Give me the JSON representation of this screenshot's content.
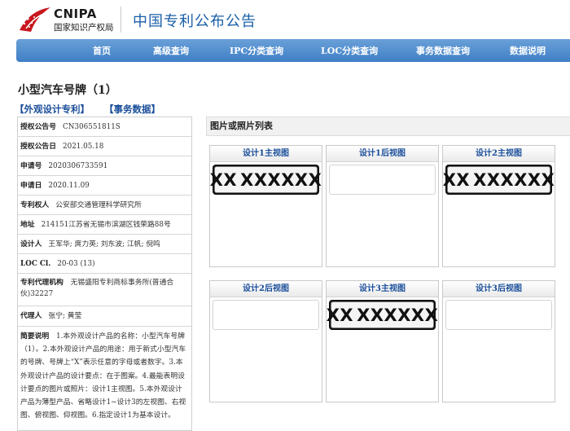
{
  "header": {
    "logo_text": "CNIPA",
    "logo_sub": "国家知识产权局",
    "site_title": "中国专利公布公告"
  },
  "nav": {
    "items": [
      "首页",
      "高级查询",
      "IPC分类查询",
      "LOC分类查询",
      "事务数据查询",
      "数据说明"
    ]
  },
  "page_title": "小型汽车号牌（1）",
  "tabs": [
    "【外观设计专利】",
    "【事务数据】"
  ],
  "info": {
    "grant_no_label": "授权公告号",
    "grant_no": "CN306551811S",
    "grant_date_label": "授权公告日",
    "grant_date": "2021.05.18",
    "app_no_label": "申请号",
    "app_no": "2020306733591",
    "app_date_label": "申请日",
    "app_date": "2020.11.09",
    "patentee_label": "专利权人",
    "patentee": "公安部交通管理科学研究所",
    "address_label": "地址",
    "address": "214151江苏省无锡市滨湖区钱荣路88号",
    "designer_label": "设计人",
    "designer": "王军华; 庹力英; 刘东波; 江帆; 倪鸣",
    "loc_label": "LOC Cl.",
    "loc": "20-03 (13)",
    "agency_label": "专利代理机构",
    "agency": "无锡盛阳专利商标事务所(普通合伙)32227",
    "agent_label": "代理人",
    "agent": "张宁; 黄莹",
    "summary_label": "简要说明",
    "summary": "1.本外观设计产品的名称：小型汽车号牌（1）。2.本外观设计产品的用途：用于新式小型汽车的号牌、号牌上“X”表示任意的字母或者数字。3.本外观设计产品的设计要点：在于图案。4.最能表明设计要点的图片或照片：设计1主视图。5.本外观设计产品为薄型产品、省略设计1~设计3的左视图、右视图、俯视图、仰视图。6.指定设计1为基本设计。"
  },
  "images_panel": {
    "title": "图片或照片列表",
    "cards": [
      {
        "label": "设计1主视图",
        "has_plate": true,
        "plate_left": "XX",
        "plate_right": "XXXXXX",
        "dot_color": "#3b6bd0"
      },
      {
        "label": "设计1后视图",
        "has_plate": false
      },
      {
        "label": "设计2主视图",
        "has_plate": true,
        "plate_left": "XX",
        "plate_right": "XXXXXX",
        "dot_color": "#e0a020"
      },
      {
        "label": "设计2后视图",
        "has_plate": false
      },
      {
        "label": "设计3主视图",
        "has_plate": true,
        "plate_left": "XX",
        "plate_right": "XXXXXX",
        "dot_color": "#d03030"
      },
      {
        "label": "设计3后视图",
        "has_plate": false
      }
    ]
  }
}
